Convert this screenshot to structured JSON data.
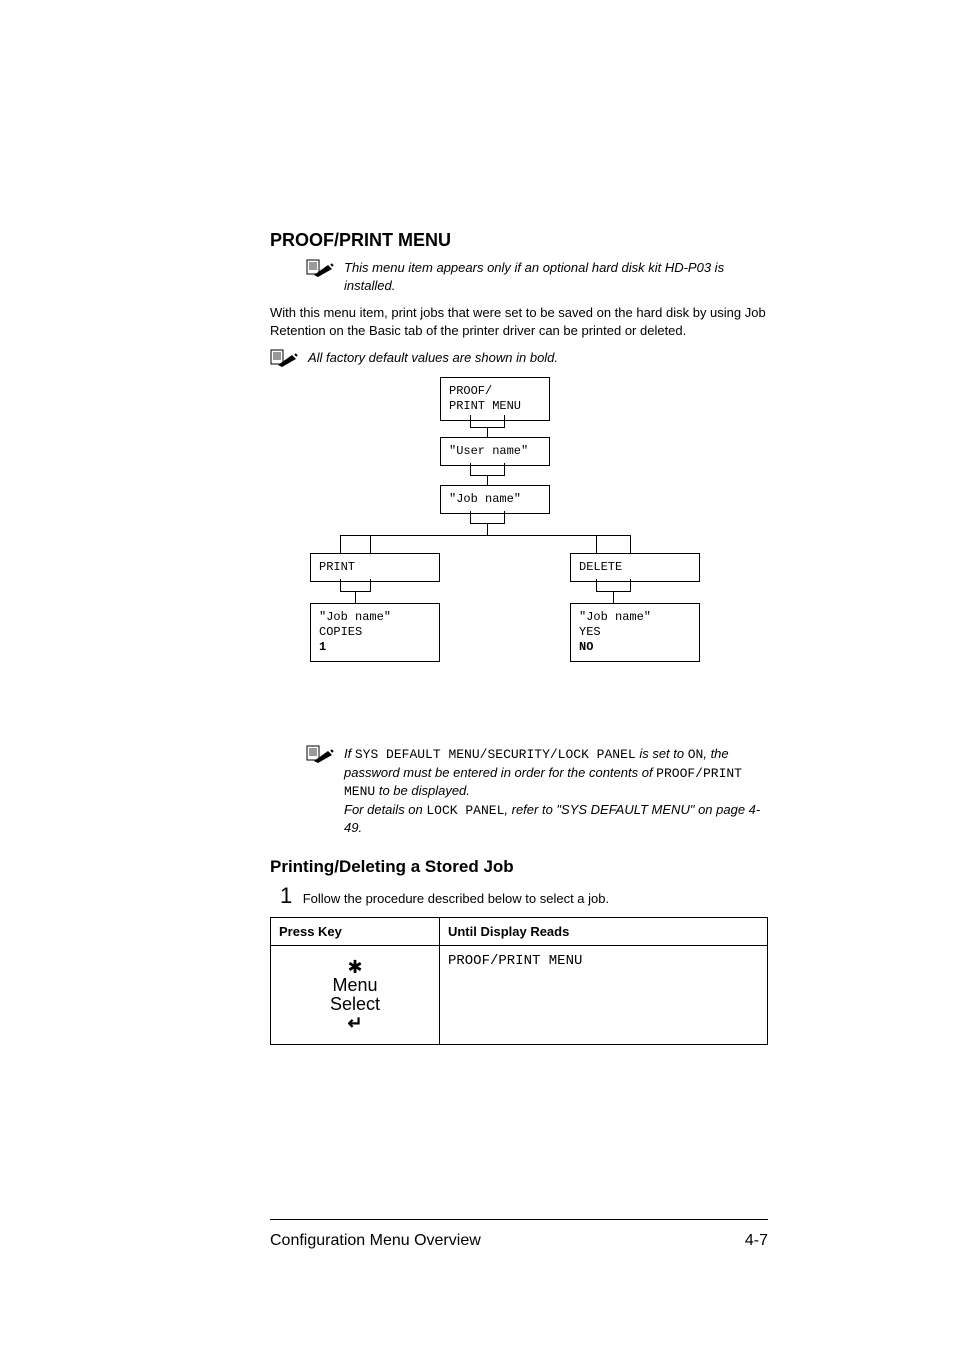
{
  "section_title": "PROOF/PRINT MENU",
  "note1": "This menu item appears only if an optional hard disk kit HD-P03 is installed.",
  "body_para": "With this menu item, print jobs that were set to be saved on the hard disk by using Job Retention on the Basic tab of the printer driver can be printed or deleted.",
  "note2": "All factory default values are shown in bold.",
  "diagram": {
    "proof_print_menu_l1": "PROOF/",
    "proof_print_menu_l2": "PRINT MENU",
    "user_name": "\"User name\"",
    "job_name": "\"Job name\"",
    "print": "PRINT",
    "delete": "DELETE",
    "left_l1": "\"Job name\"",
    "left_l2": "COPIES",
    "left_l3": "1",
    "right_l1": "\"Job name\"",
    "right_l2": "YES",
    "right_l3": "NO"
  },
  "note3": {
    "part1": "If ",
    "code1": "SYS DEFAULT MENU/SECURITY/LOCK PANEL",
    "part2": " is set to ",
    "code2": "ON",
    "part3": ", the password must be entered in order for the contents of ",
    "code3": "PROOF/PRINT MENU",
    "part4": " to be displayed.",
    "line2a": "For details on ",
    "code4": "LOCK PANEL",
    "line2b": ", refer to \"SYS DEFAULT MENU\" on page 4-49."
  },
  "subsection_title": "Printing/Deleting a Stored Job",
  "step_num": "1",
  "step_text": "Follow the procedure described below to select a job.",
  "table": {
    "header1": "Press Key",
    "header2": "Until Display Reads",
    "menu_line1": "Menu",
    "menu_line2": "Select",
    "display_value": "PROOF/PRINT MENU"
  },
  "footer_left": "Configuration Menu Overview",
  "footer_right": "4-7"
}
